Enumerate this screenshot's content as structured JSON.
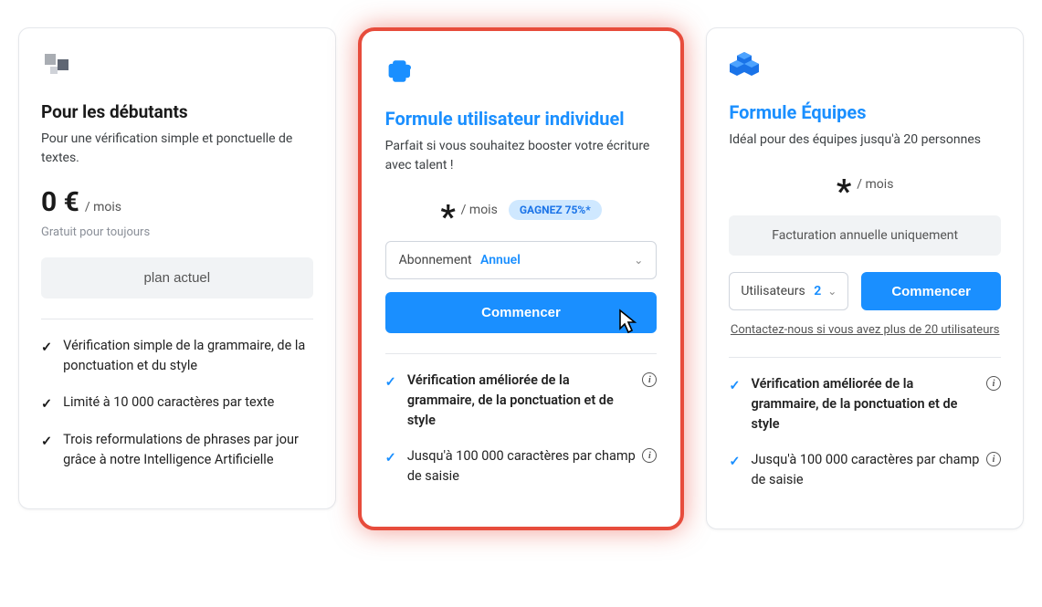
{
  "plans": {
    "starter": {
      "title": "Pour les débutants",
      "subtitle": "Pour une vérification simple et ponctuelle de textes.",
      "price": "0 €",
      "per": "/ mois",
      "free_note": "Gratuit pour toujours",
      "current_label": "plan actuel",
      "features": [
        "Vérification simple de la grammaire, de la ponctuation et du style",
        "Limité à 10 000 caractères par texte",
        "Trois reformulations de phrases par jour grâce à notre Intelligence Artificielle"
      ]
    },
    "individual": {
      "title": "Formule utilisateur individuel",
      "subtitle": "Parfait si vous souhaitez booster votre écriture avec talent !",
      "price_asterisk": "*",
      "per": "/ mois",
      "savings": "GAGNEZ 75%*",
      "subscription_label": "Abonnement",
      "subscription_value": "Annuel",
      "cta": "Commencer",
      "features": [
        "Vérification améliorée de la grammaire, de la ponctuation et de style",
        "Jusqu'à 100 000 caractères par champ de saisie"
      ]
    },
    "teams": {
      "title": "Formule Équipes",
      "subtitle": "Idéal pour des équipes jusqu'à 20 personnes",
      "price_asterisk": "*",
      "per": "/ mois",
      "billing_note": "Facturation annuelle uniquement",
      "users_label": "Utilisateurs",
      "users_value": "2",
      "cta": "Commencer",
      "contact": "Contactez-nous si vous avez plus de 20 utilisateurs",
      "features": [
        "Vérification améliorée de la grammaire, de la ponctuation et de style",
        "Jusqu'à 100 000 caractères par champ de saisie"
      ]
    }
  }
}
